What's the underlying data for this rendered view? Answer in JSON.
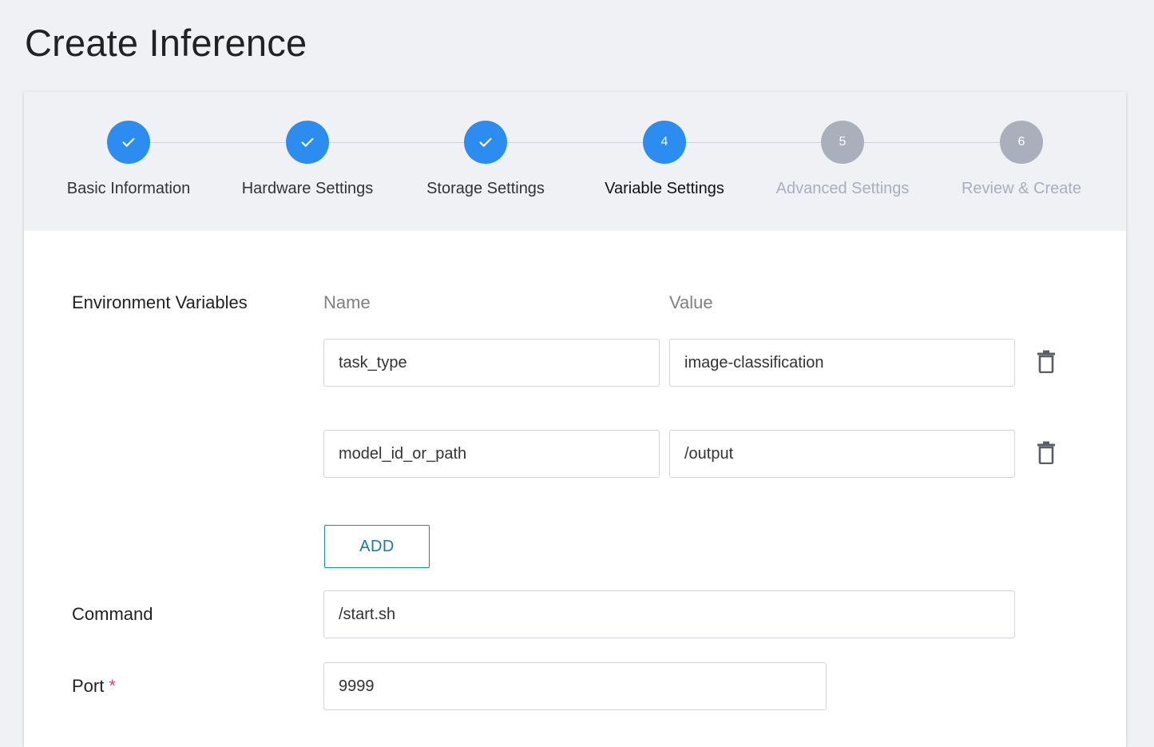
{
  "page": {
    "title": "Create Inference"
  },
  "steps": [
    {
      "label": "Basic Information",
      "state": "done",
      "icon": "check-icon"
    },
    {
      "label": "Hardware Settings",
      "state": "done",
      "icon": "check-icon"
    },
    {
      "label": "Storage Settings",
      "state": "done",
      "icon": "check-icon"
    },
    {
      "label": "Variable Settings",
      "state": "current",
      "number": "4"
    },
    {
      "label": "Advanced Settings",
      "state": "pending",
      "number": "5"
    },
    {
      "label": "Review & Create",
      "state": "pending",
      "number": "6"
    }
  ],
  "env": {
    "label": "Environment Variables",
    "name_header": "Name",
    "value_header": "Value",
    "rows": [
      {
        "name": "task_type",
        "value": "image-classification"
      },
      {
        "name": "model_id_or_path",
        "value": "/output"
      }
    ],
    "add_label": "ADD"
  },
  "command": {
    "label": "Command",
    "value": "/start.sh"
  },
  "port": {
    "label": "Port",
    "required_mark": "*",
    "value": "9999"
  },
  "colors": {
    "accent": "#2d8cf0",
    "pending": "#a9afbb",
    "button": "#1a7d95",
    "required": "#ed3f7c"
  }
}
